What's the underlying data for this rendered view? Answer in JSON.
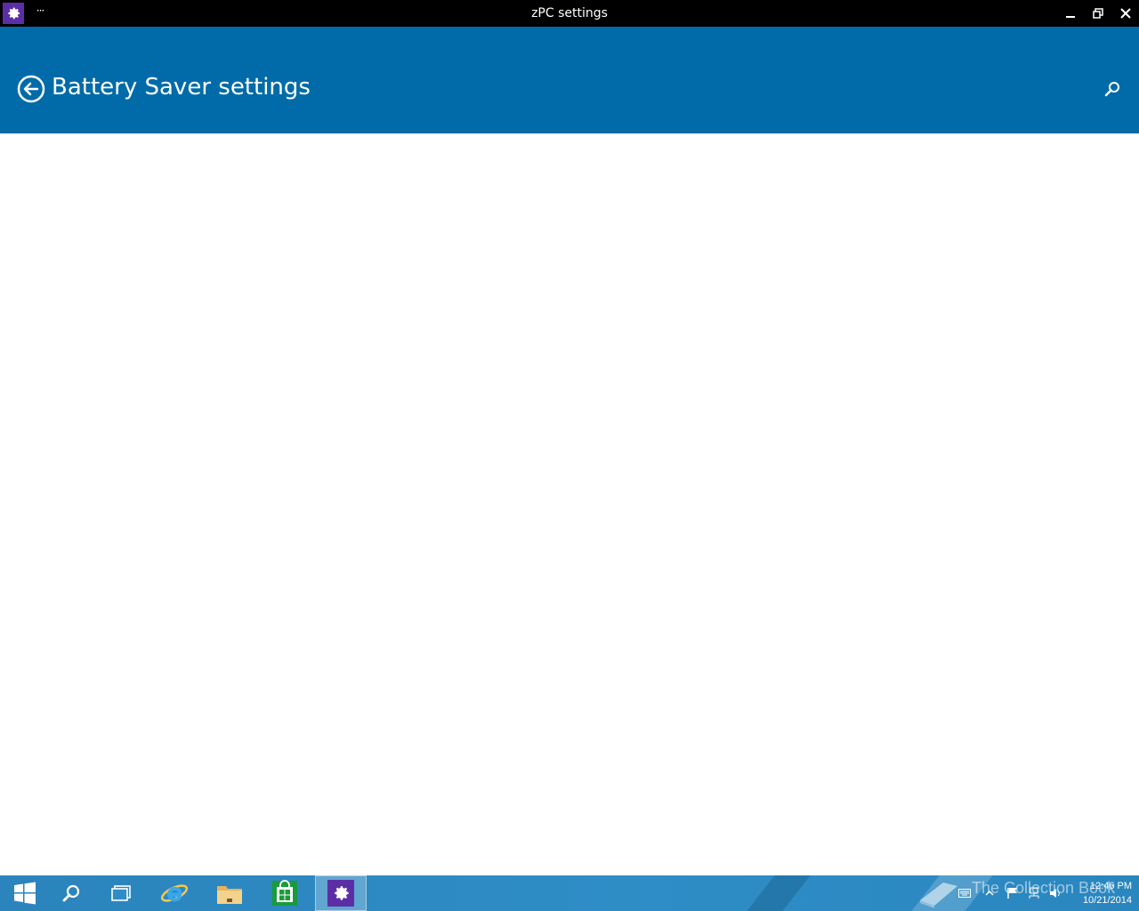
{
  "window": {
    "title": "zPC settings",
    "more_label": "···",
    "app_icon": "gear-icon"
  },
  "header": {
    "title": "Battery Saver settings",
    "back_icon": "back-arrow-icon",
    "search_icon": "search-icon"
  },
  "taskbar": {
    "items": [
      "start-icon",
      "search-icon",
      "task-view-icon",
      "internet-explorer-icon",
      "file-explorer-icon",
      "store-icon",
      "settings-gear-icon"
    ],
    "watermark": "The Collection Book",
    "clock": {
      "time": "12:46 PM",
      "date": "10/21/2014"
    }
  },
  "colors": {
    "header_bg": "#006ba8",
    "titlebar_bg": "#000000",
    "taskbar_bg": "#2f8dc6",
    "app_accent": "#5b2ea6"
  }
}
